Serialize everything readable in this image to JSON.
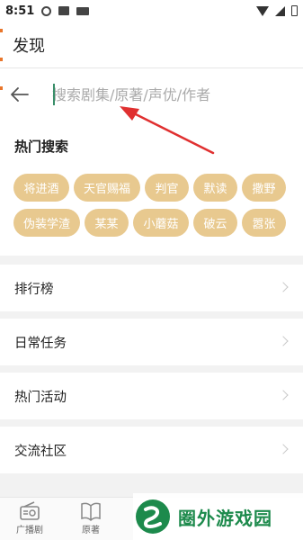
{
  "status_bar": {
    "time": "8:51"
  },
  "title_bar": {
    "title": "发现"
  },
  "search": {
    "placeholder": "搜索剧集/原著/声优/作者"
  },
  "hot_search": {
    "title": "热门搜索",
    "tags": [
      "将进酒",
      "天官赐福",
      "判官",
      "默读",
      "撒野",
      "伪装学渣",
      "某某",
      "小蘑菇",
      "破云",
      "嚣张"
    ]
  },
  "menu": {
    "items": [
      {
        "label": "排行榜"
      },
      {
        "label": "日常任务"
      },
      {
        "label": "热门活动"
      },
      {
        "label": "交流社区"
      }
    ]
  },
  "bottom_nav": {
    "items": [
      {
        "label": "广播剧",
        "icon": "radio-icon"
      },
      {
        "label": "原著",
        "icon": "book-icon"
      }
    ]
  },
  "annotation": {
    "color": "#e03030",
    "arrow_icon": "red-arrow-icon"
  },
  "watermark": {
    "text": "圈外游戏园",
    "color": "#1d8a4c"
  },
  "colors": {
    "chip_bg": "#e8c98f",
    "cursor": "#3a8f6a"
  }
}
